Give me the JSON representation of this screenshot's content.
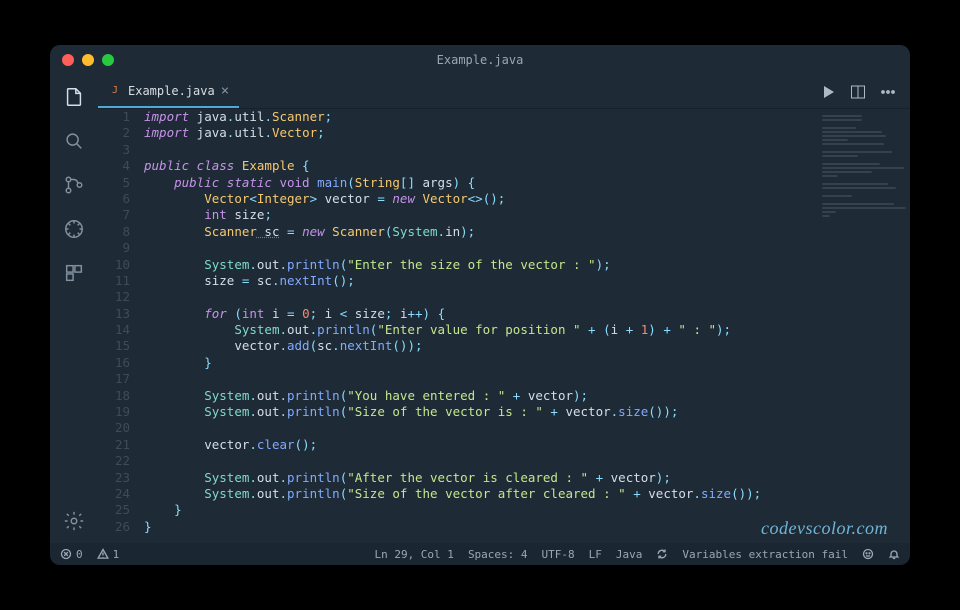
{
  "window": {
    "title": "Example.java"
  },
  "tab": {
    "filename": "Example.java",
    "lang_badge": "J"
  },
  "actions": {
    "run": "▶",
    "split": "⧉",
    "more": "⋯"
  },
  "gutter": {
    "start": 1,
    "end": 26
  },
  "code_lines": [
    [
      [
        "kw",
        "import"
      ],
      [
        "",
        ""
      ],
      [
        "pkg",
        " java"
      ],
      [
        "op",
        "."
      ],
      [
        "pkg",
        "util"
      ],
      [
        "op",
        "."
      ],
      [
        "type",
        "Scanner"
      ],
      [
        "op",
        ";"
      ]
    ],
    [
      [
        "kw",
        "import"
      ],
      [
        "",
        ""
      ],
      [
        "pkg",
        " java"
      ],
      [
        "op",
        "."
      ],
      [
        "pkg",
        "util"
      ],
      [
        "op",
        "."
      ],
      [
        "type",
        "Vector"
      ],
      [
        "op",
        ";"
      ]
    ],
    [],
    [
      [
        "kw",
        "public"
      ],
      [
        "",
        ""
      ],
      [
        "kw",
        " class"
      ],
      [
        "",
        ""
      ],
      [
        "type",
        " Example"
      ],
      [
        "",
        ""
      ],
      [
        "op",
        " {"
      ]
    ],
    [
      [
        "",
        "    "
      ],
      [
        "kw",
        "public"
      ],
      [
        "",
        ""
      ],
      [
        "kw",
        " static"
      ],
      [
        "",
        ""
      ],
      [
        "kw2",
        " void"
      ],
      [
        "",
        ""
      ],
      [
        "fn",
        " main"
      ],
      [
        "op",
        "("
      ],
      [
        "type",
        "String"
      ],
      [
        "op",
        "[]"
      ],
      [
        "id",
        " args"
      ],
      [
        "op",
        ") {"
      ]
    ],
    [
      [
        "",
        "        "
      ],
      [
        "type",
        "Vector"
      ],
      [
        "op",
        "<"
      ],
      [
        "type",
        "Integer"
      ],
      [
        "op",
        ">"
      ],
      [
        "id",
        " vector"
      ],
      [
        "op",
        " = "
      ],
      [
        "kw",
        "new"
      ],
      [
        "",
        ""
      ],
      [
        "type",
        " Vector"
      ],
      [
        "op",
        "<>();"
      ]
    ],
    [
      [
        "",
        "        "
      ],
      [
        "kw2",
        "int"
      ],
      [
        "id",
        " size"
      ],
      [
        "op",
        ";"
      ]
    ],
    [
      [
        "",
        "        "
      ],
      [
        "type",
        "Scanner"
      ],
      [
        "",
        ""
      ],
      [
        "id und",
        " sc"
      ],
      [
        "op",
        " = "
      ],
      [
        "kw",
        "new"
      ],
      [
        "",
        ""
      ],
      [
        "type",
        " Scanner"
      ],
      [
        "op",
        "("
      ],
      [
        "obj",
        "System"
      ],
      [
        "op",
        "."
      ],
      [
        "id",
        "in"
      ],
      [
        "op",
        ");"
      ]
    ],
    [],
    [
      [
        "",
        "        "
      ],
      [
        "obj",
        "System"
      ],
      [
        "op",
        "."
      ],
      [
        "id",
        "out"
      ],
      [
        "op",
        "."
      ],
      [
        "fn",
        "println"
      ],
      [
        "op",
        "("
      ],
      [
        "str",
        "\"Enter the size of the vector : \""
      ],
      [
        "op",
        ");"
      ]
    ],
    [
      [
        "",
        "        "
      ],
      [
        "id",
        "size"
      ],
      [
        "op",
        " = "
      ],
      [
        "id",
        "sc"
      ],
      [
        "op",
        "."
      ],
      [
        "fn",
        "nextInt"
      ],
      [
        "op",
        "();"
      ]
    ],
    [],
    [
      [
        "",
        "        "
      ],
      [
        "kw",
        "for"
      ],
      [
        "op",
        " ("
      ],
      [
        "kw2",
        "int"
      ],
      [
        "id",
        " i"
      ],
      [
        "op",
        " = "
      ],
      [
        "num",
        "0"
      ],
      [
        "op",
        "; "
      ],
      [
        "id",
        "i"
      ],
      [
        "op",
        " < "
      ],
      [
        "id",
        "size"
      ],
      [
        "op",
        "; "
      ],
      [
        "id",
        "i"
      ],
      [
        "op",
        "++) {"
      ]
    ],
    [
      [
        "",
        "            "
      ],
      [
        "obj",
        "System"
      ],
      [
        "op",
        "."
      ],
      [
        "id",
        "out"
      ],
      [
        "op",
        "."
      ],
      [
        "fn",
        "println"
      ],
      [
        "op",
        "("
      ],
      [
        "str",
        "\"Enter value for position \""
      ],
      [
        "op",
        " + ("
      ],
      [
        "id",
        "i"
      ],
      [
        "op",
        " + "
      ],
      [
        "num",
        "1"
      ],
      [
        "op",
        ") + "
      ],
      [
        "str",
        "\" : \""
      ],
      [
        "op",
        ");"
      ]
    ],
    [
      [
        "",
        "            "
      ],
      [
        "id",
        "vector"
      ],
      [
        "op",
        "."
      ],
      [
        "fn",
        "add"
      ],
      [
        "op",
        "("
      ],
      [
        "id",
        "sc"
      ],
      [
        "op",
        "."
      ],
      [
        "fn",
        "nextInt"
      ],
      [
        "op",
        "());"
      ]
    ],
    [
      [
        "",
        "        "
      ],
      [
        "op",
        "}"
      ]
    ],
    [],
    [
      [
        "",
        "        "
      ],
      [
        "obj",
        "System"
      ],
      [
        "op",
        "."
      ],
      [
        "id",
        "out"
      ],
      [
        "op",
        "."
      ],
      [
        "fn",
        "println"
      ],
      [
        "op",
        "("
      ],
      [
        "str",
        "\"You have entered : \""
      ],
      [
        "op",
        " + "
      ],
      [
        "id",
        "vector"
      ],
      [
        "op",
        ");"
      ]
    ],
    [
      [
        "",
        "        "
      ],
      [
        "obj",
        "System"
      ],
      [
        "op",
        "."
      ],
      [
        "id",
        "out"
      ],
      [
        "op",
        "."
      ],
      [
        "fn",
        "println"
      ],
      [
        "op",
        "("
      ],
      [
        "str",
        "\"Size of the vector is : \""
      ],
      [
        "op",
        " + "
      ],
      [
        "id",
        "vector"
      ],
      [
        "op",
        "."
      ],
      [
        "fn",
        "size"
      ],
      [
        "op",
        "());"
      ]
    ],
    [],
    [
      [
        "",
        "        "
      ],
      [
        "id",
        "vector"
      ],
      [
        "op",
        "."
      ],
      [
        "fn",
        "clear"
      ],
      [
        "op",
        "();"
      ]
    ],
    [],
    [
      [
        "",
        "        "
      ],
      [
        "obj",
        "System"
      ],
      [
        "op",
        "."
      ],
      [
        "id",
        "out"
      ],
      [
        "op",
        "."
      ],
      [
        "fn",
        "println"
      ],
      [
        "op",
        "("
      ],
      [
        "str",
        "\"After the vector is cleared : \""
      ],
      [
        "op",
        " + "
      ],
      [
        "id",
        "vector"
      ],
      [
        "op",
        ");"
      ]
    ],
    [
      [
        "",
        "        "
      ],
      [
        "obj",
        "System"
      ],
      [
        "op",
        "."
      ],
      [
        "id",
        "out"
      ],
      [
        "op",
        "."
      ],
      [
        "fn",
        "println"
      ],
      [
        "op",
        "("
      ],
      [
        "str",
        "\"Size of the vector after cleared : \""
      ],
      [
        "op",
        " + "
      ],
      [
        "id",
        "vector"
      ],
      [
        "op",
        "."
      ],
      [
        "fn",
        "size"
      ],
      [
        "op",
        "());"
      ]
    ],
    [
      [
        "",
        "    "
      ],
      [
        "op",
        "}"
      ]
    ],
    [
      [
        "op",
        "}"
      ]
    ]
  ],
  "status": {
    "errors": "0",
    "warnings": "1",
    "cursor": "Ln 29, Col 1",
    "indent": "Spaces: 4",
    "encoding": "UTF-8",
    "eol": "LF",
    "language": "Java",
    "message": "Variables extraction fail"
  },
  "watermark": "codevscolor.com",
  "minimap_widths": [
    40,
    40,
    0,
    34,
    60,
    64,
    26,
    62,
    0,
    70,
    36,
    0,
    58,
    82,
    50,
    16,
    0,
    66,
    74,
    0,
    30,
    0,
    72,
    84,
    14,
    8
  ]
}
